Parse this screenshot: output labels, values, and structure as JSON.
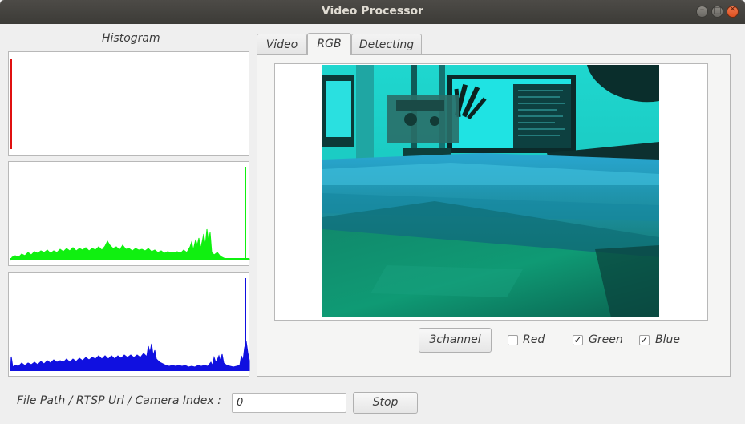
{
  "window": {
    "title": "Video Processor"
  },
  "histogram": {
    "title": "Histogram",
    "red_color": "#e01010",
    "green_color": "#10f010",
    "blue_color": "#1010e0"
  },
  "tabs": [
    {
      "label": "Video",
      "active": false
    },
    {
      "label": "RGB",
      "active": true
    },
    {
      "label": "Detecting",
      "active": false
    }
  ],
  "controls": {
    "mode_button": "3channel",
    "channels": [
      {
        "label": "Red",
        "checked": false
      },
      {
        "label": "Green",
        "checked": true
      },
      {
        "label": "Blue",
        "checked": true
      }
    ]
  },
  "source": {
    "label": "File Path / RTSP Url / Camera Index :",
    "value": "0",
    "stop_label": "Stop"
  }
}
